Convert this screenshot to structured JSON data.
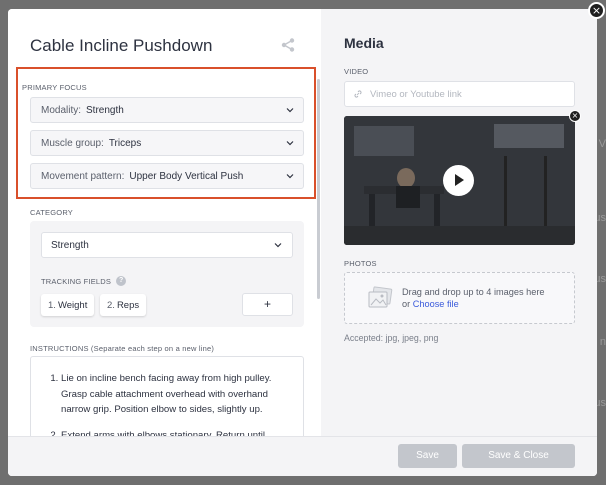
{
  "background": {
    "snippets": [
      "V",
      "us",
      "us",
      "us",
      "n"
    ]
  },
  "modal": {
    "title": "Cable Incline Pushdown",
    "close": "×"
  },
  "primary_focus": {
    "label": "PRIMARY FOCUS",
    "modality": {
      "key": "Modality:",
      "value": "Strength"
    },
    "muscle_group": {
      "key": "Muscle group:",
      "value": "Triceps"
    },
    "movement_pattern": {
      "key": "Movement pattern:",
      "value": "Upper Body Vertical Push"
    }
  },
  "category": {
    "label": "CATEGORY",
    "value": "Strength",
    "tracking_label": "TRACKING FIELDS",
    "help": "?",
    "fields": [
      {
        "num": "1.",
        "name": "Weight"
      },
      {
        "num": "2.",
        "name": "Reps"
      }
    ],
    "add": "+"
  },
  "instructions": {
    "label": "INSTRUCTIONS (Separate each step on a new line)",
    "steps": [
      "Lie on incline bench facing away from high pulley. Grasp cable attachment overhead with overhand narrow grip. Position elbow to sides, slightly up.",
      "Extend arms with elbows stationary. Return until"
    ]
  },
  "footer": {
    "save": "Save",
    "save_close": "Save & Close"
  },
  "media": {
    "title": "Media",
    "video_label": "VIDEO",
    "video_placeholder": "Vimeo or Youtube link",
    "photos_label": "PHOTOS",
    "drop_text": "Drag and drop up to 4 images here",
    "drop_or": "or ",
    "choose_file": "Choose file",
    "accepted": "Accepted: jpg, jpeg, png",
    "remove": "×"
  },
  "colors": {
    "highlight_border": "#d9502b",
    "link": "#3b5bdb",
    "disabled_button": "#c3c6cc"
  }
}
